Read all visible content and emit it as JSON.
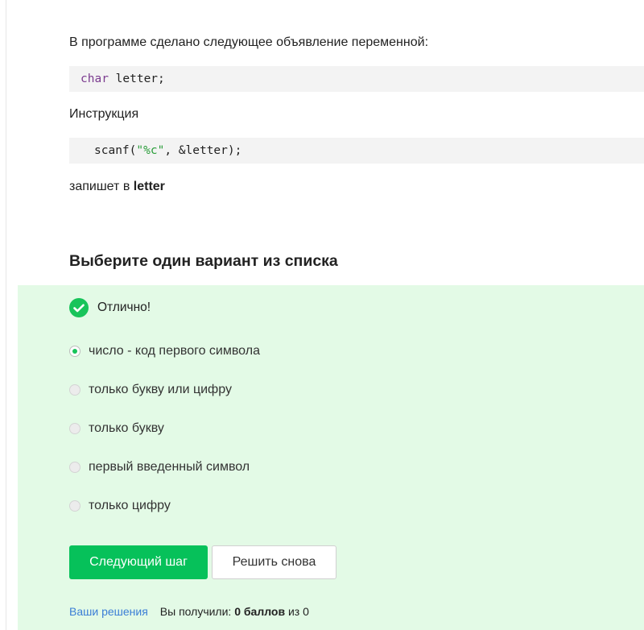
{
  "question": {
    "intro": "В программе сделано следующее объявление переменной:",
    "code1": {
      "keyword": "char",
      "rest": " letter;"
    },
    "instruction_label": "Инструкция",
    "code2": {
      "pre": "scanf(",
      "string": "\"%c\"",
      "post": ", &letter);"
    },
    "writes_prefix": "запишет в ",
    "writes_var": "letter"
  },
  "quiz": {
    "title": "Выберите один вариант из списка",
    "status_text": "Отлично!",
    "options": [
      {
        "label": "число - код первого символа",
        "selected": true
      },
      {
        "label": "только букву или цифру",
        "selected": false
      },
      {
        "label": "только букву",
        "selected": false
      },
      {
        "label": "первый введенный символ",
        "selected": false
      },
      {
        "label": "только цифру",
        "selected": false
      }
    ],
    "next_button": "Следующий шаг",
    "retry_button": "Решить снова",
    "solutions_link": "Ваши решения",
    "score_prefix": "Вы получили: ",
    "score_value": "0 баллов",
    "score_suffix": " из 0"
  },
  "colors": {
    "panel_bg": "#e3fae6",
    "accent_green": "#06c15a",
    "link_blue": "#3b7ed6"
  },
  "icons": {
    "status": "check-circle-icon"
  }
}
